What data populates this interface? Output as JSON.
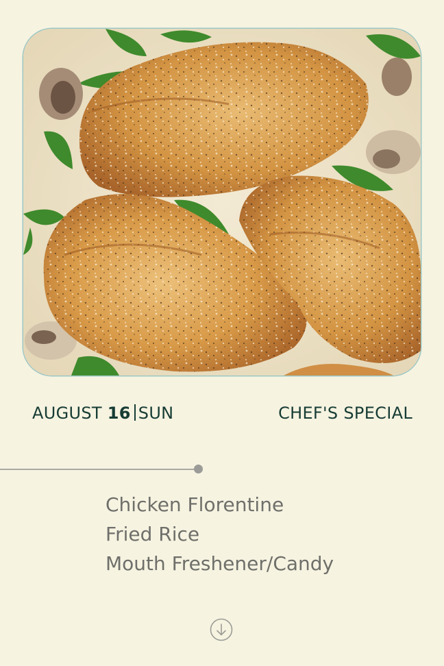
{
  "header": {
    "month": "AUGUST",
    "day": "16",
    "weekday": "SUN",
    "tag": "CHEF'S SPECIAL"
  },
  "menu": {
    "items": [
      "Chicken Florentine",
      "Fried Rice",
      "Mouth Freshener/Candy"
    ]
  },
  "icons": {
    "scroll": "arrow-down-circle-icon"
  },
  "colors": {
    "background": "#f6f3e1",
    "heading": "#173c34",
    "menu_text": "#6f6f6a",
    "photo_border": "#9cc7c4",
    "timeline": "#a9a9a2"
  }
}
